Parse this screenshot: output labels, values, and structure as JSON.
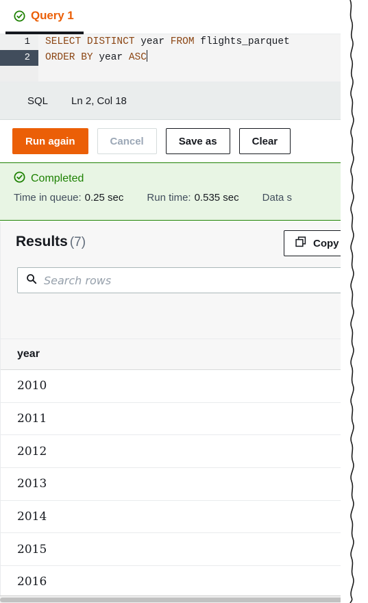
{
  "tab": {
    "label": "Query 1",
    "status_icon": "check-circle-icon",
    "accent_color": "#eb5f07"
  },
  "editor": {
    "language": "SQL",
    "cursor_position": "Ln 2, Col 18",
    "active_line": 2,
    "lines": [
      {
        "number": "1",
        "tokens": [
          {
            "text": "SELECT DISTINCT ",
            "type": "keyword"
          },
          {
            "text": "year ",
            "type": "identifier"
          },
          {
            "text": "FROM ",
            "type": "keyword"
          },
          {
            "text": "flights_parquet",
            "type": "identifier"
          }
        ]
      },
      {
        "number": "2",
        "tokens": [
          {
            "text": "ORDER BY ",
            "type": "keyword"
          },
          {
            "text": "year ",
            "type": "identifier"
          },
          {
            "text": "ASC",
            "type": "keyword"
          }
        ]
      }
    ]
  },
  "actions": {
    "run_again": "Run again",
    "cancel": "Cancel",
    "save_as": "Save as",
    "clear": "Clear"
  },
  "banner": {
    "status": "Completed",
    "status_color": "#1d8102",
    "background": "#e8f5e4",
    "stats": [
      {
        "label": "Time in queue:",
        "value": "0.25 sec"
      },
      {
        "label": "Run time:",
        "value": "0.535 sec"
      },
      {
        "label": "Data s",
        "value": ""
      }
    ]
  },
  "results": {
    "title": "Results",
    "count": "(7)",
    "copy_label": "Copy",
    "copy_icon": "copy-icon",
    "search": {
      "placeholder": "Search rows",
      "value": "",
      "icon": "search-icon"
    },
    "columns": [
      "year"
    ],
    "rows": [
      [
        "2010"
      ],
      [
        "2011"
      ],
      [
        "2012"
      ],
      [
        "2013"
      ],
      [
        "2014"
      ],
      [
        "2015"
      ],
      [
        "2016"
      ]
    ]
  }
}
